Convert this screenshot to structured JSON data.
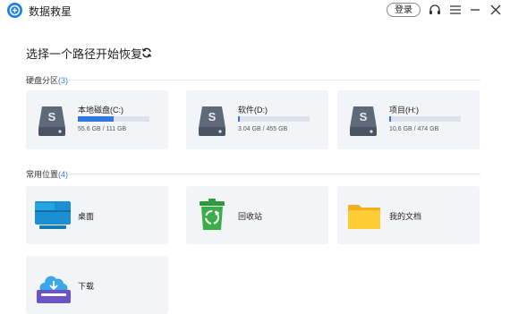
{
  "app": {
    "title": "数据救星",
    "login_label": "登录"
  },
  "icons": {
    "logo": "plus-circle-icon",
    "support": "headset-icon",
    "menu": "hamburger-menu-icon",
    "minimize": "minimize-icon",
    "close": "close-icon",
    "refresh": "refresh-icon"
  },
  "main": {
    "heading": "选择一个路径开始恢复"
  },
  "disks_section": {
    "label": "硬盘分区",
    "count": "(3)",
    "drives": [
      {
        "name": "本地磁盘(C:)",
        "size": "55.6 GB / 111 GB",
        "used_fraction": 0.5
      },
      {
        "name": "软件(D:)",
        "size": "3.04 GB / 455 GB",
        "used_fraction": 0.007
      },
      {
        "name": "项目(H:)",
        "size": "10.6 GB / 474 GB",
        "used_fraction": 0.022
      }
    ]
  },
  "locations_section": {
    "label": "常用位置",
    "count": "(4)",
    "items": [
      {
        "name": "桌面",
        "icon": "desktop-monitor-icon"
      },
      {
        "name": "回收站",
        "icon": "recycle-bin-icon"
      },
      {
        "name": "我的文档",
        "icon": "folder-icon"
      },
      {
        "name": "下载",
        "icon": "download-tray-icon"
      }
    ]
  },
  "colors": {
    "accent": "#1e7cf2",
    "progress": "#2f78e0",
    "card": "#f3f4f8",
    "count_text": "#3b7bd8"
  }
}
